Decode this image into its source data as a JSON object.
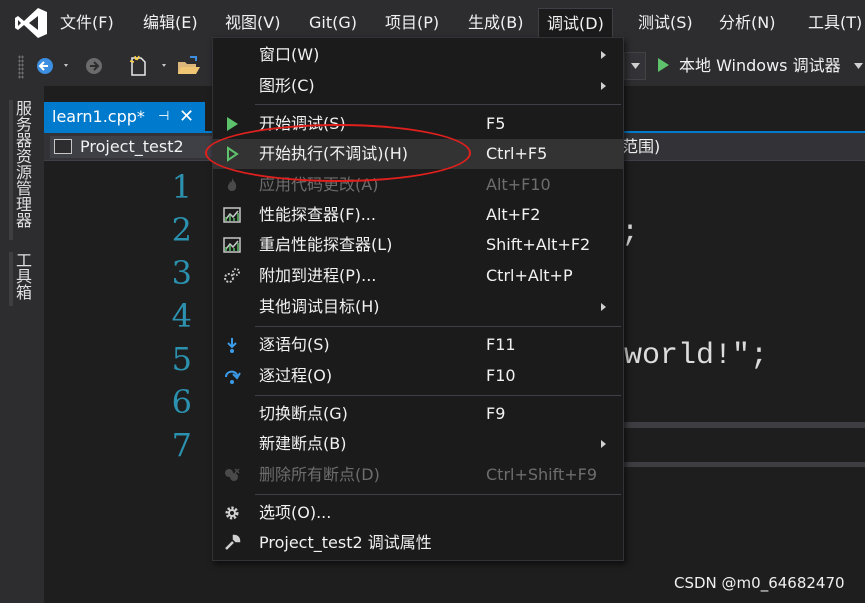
{
  "menubar": {
    "items": [
      "文件(F)",
      "编辑(E)",
      "视图(V)",
      "Git(G)",
      "项目(P)",
      "生成(B)",
      "调试(D)",
      "测试(S)",
      "分析(N)",
      "工具(T)"
    ]
  },
  "toolbar": {
    "debug_target": "本地 Windows 调试器"
  },
  "sidestrip": {
    "tabs": [
      "服务器资源管理器",
      "工具箱"
    ]
  },
  "document_tab": {
    "title": "learn1.cpp*",
    "pin": "⊣",
    "close": "✕"
  },
  "navbar": {
    "project": "Project_test2",
    "scope": "范围)"
  },
  "editor": {
    "line_numbers": [
      "1",
      "2",
      "3",
      "4",
      "5",
      "6",
      "7"
    ],
    "visible_code": [
      ";",
      "world!\";"
    ]
  },
  "debug_menu": {
    "items": [
      {
        "label": "窗口(W)",
        "shortcut": "",
        "submenu": true,
        "icon": "none"
      },
      {
        "label": "图形(C)",
        "shortcut": "",
        "submenu": true,
        "icon": "none"
      },
      {
        "label": "开始调试(S)",
        "shortcut": "F5",
        "submenu": false,
        "icon": "play-icon"
      },
      {
        "label": "开始执行(不调试)(H)",
        "shortcut": "Ctrl+F5",
        "submenu": false,
        "icon": "play-outline-icon"
      },
      {
        "label": "应用代码更改(A)",
        "shortcut": "Alt+F10",
        "submenu": false,
        "icon": "flame-icon",
        "disabled": true
      },
      {
        "label": "性能探查器(F)...",
        "shortcut": "Alt+F2",
        "submenu": false,
        "icon": "chart-icon"
      },
      {
        "label": "重启性能探查器(L)",
        "shortcut": "Shift+Alt+F2",
        "submenu": false,
        "icon": "chart-icon"
      },
      {
        "label": "附加到进程(P)...",
        "shortcut": "Ctrl+Alt+P",
        "submenu": false,
        "icon": "gears-icon"
      },
      {
        "label": "其他调试目标(H)",
        "shortcut": "",
        "submenu": true,
        "icon": "none"
      },
      {
        "label": "逐语句(S)",
        "shortcut": "F11",
        "submenu": false,
        "icon": "step-into-icon"
      },
      {
        "label": "逐过程(O)",
        "shortcut": "F10",
        "submenu": false,
        "icon": "step-over-icon"
      },
      {
        "label": "切换断点(G)",
        "shortcut": "F9",
        "submenu": false,
        "icon": "none"
      },
      {
        "label": "新建断点(B)",
        "shortcut": "",
        "submenu": true,
        "icon": "none"
      },
      {
        "label": "删除所有断点(D)",
        "shortcut": "Ctrl+Shift+F9",
        "submenu": false,
        "icon": "delete-breakpoints-icon",
        "disabled": true
      },
      {
        "label": "选项(O)...",
        "shortcut": "",
        "submenu": false,
        "icon": "gear-icon"
      },
      {
        "label": "Project_test2 调试属性",
        "shortcut": "",
        "submenu": false,
        "icon": "wrench-icon"
      }
    ]
  },
  "colors": {
    "accent": "#007acc",
    "annotation": "#e0201c",
    "line_number": "#2b91af",
    "play": "#5ec16b"
  },
  "watermark": "CSDN @m0_64682470"
}
